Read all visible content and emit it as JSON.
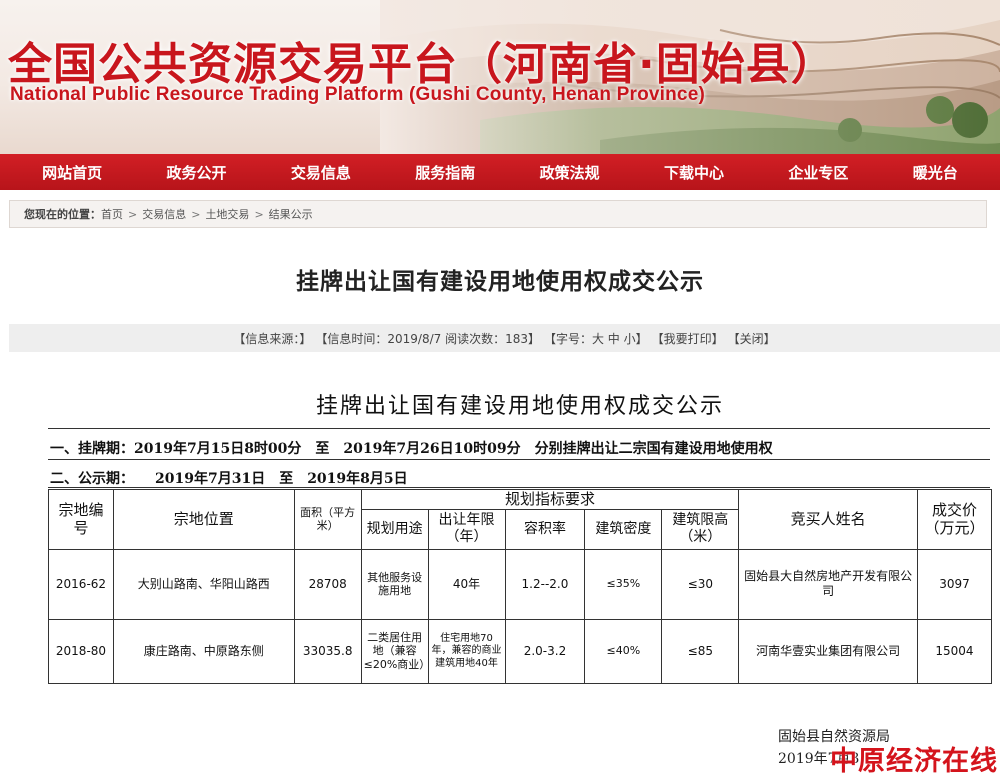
{
  "header": {
    "title": "全国公共资源交易平台（河南省·固始县）",
    "subtitle": "National Public Resource Trading Platform (Gushi County, Henan Province)"
  },
  "nav": [
    "网站首页",
    "政务公开",
    "交易信息",
    "服务指南",
    "政策法规",
    "下载中心",
    "企业专区",
    "暖光台"
  ],
  "breadcrumb": {
    "label": "您现在的位置：",
    "items": [
      "首页",
      "交易信息",
      "土地交易",
      "结果公示"
    ],
    "separator": ">"
  },
  "article": {
    "title": "挂牌出让国有建设用地使用权成交公示",
    "meta": {
      "source": "【信息来源：】",
      "time": "【信息时间：2019/8/7 阅读次数：183】",
      "font_size": "【字号：大 中 小】",
      "print": "【我要打印】",
      "close": "【关闭】"
    }
  },
  "document": {
    "title": "挂牌出让国有建设用地使用权成交公示",
    "line1": "一、挂牌期：2019年7月15日8时00分　至　2019年7月26日10时09分　分别挂牌出让二宗国有建设用地使用权",
    "line2": "二、公示期：　　2019年7月31日　至　2019年8月5日"
  },
  "table": {
    "headers": {
      "parcel_no": "宗地编号",
      "location": "宗地位置",
      "area": "面积（平方米）",
      "planning": "规划指标要求",
      "use": "规划用途",
      "term": "出让年限（年）",
      "far": "容积率",
      "density": "建筑密度",
      "height": "建筑限高（米）",
      "buyer": "竞买人姓名",
      "price": "成交价（万元）"
    },
    "rows": [
      {
        "parcel_no": "2016-62",
        "location": "大别山路南、华阳山路西",
        "area": "28708",
        "use": "其他服务设施用地",
        "term": "40年",
        "far": "1.2--2.0",
        "density": "≤35%",
        "height": "≤30",
        "buyer": "固始县大自然房地产开发有限公司",
        "price": "3097"
      },
      {
        "parcel_no": "2018-80",
        "location": "康庄路南、中原路东侧",
        "area": "33035.8",
        "use": "二类居住用地（兼容≤20%商业）",
        "term": "住宅用地70年，兼容的商业建筑用地40年",
        "far": "2.0-3.2",
        "density": "≤40%",
        "height": "≤85",
        "buyer": "河南华壹实业集团有限公司",
        "price": "15004"
      }
    ]
  },
  "footer": {
    "signature": "固始县自然资源局",
    "date": "2019年7月3",
    "watermark": "中原经济在线"
  },
  "colors": {
    "brand_red": "#c8161d",
    "nav_red": "#c41a20"
  }
}
